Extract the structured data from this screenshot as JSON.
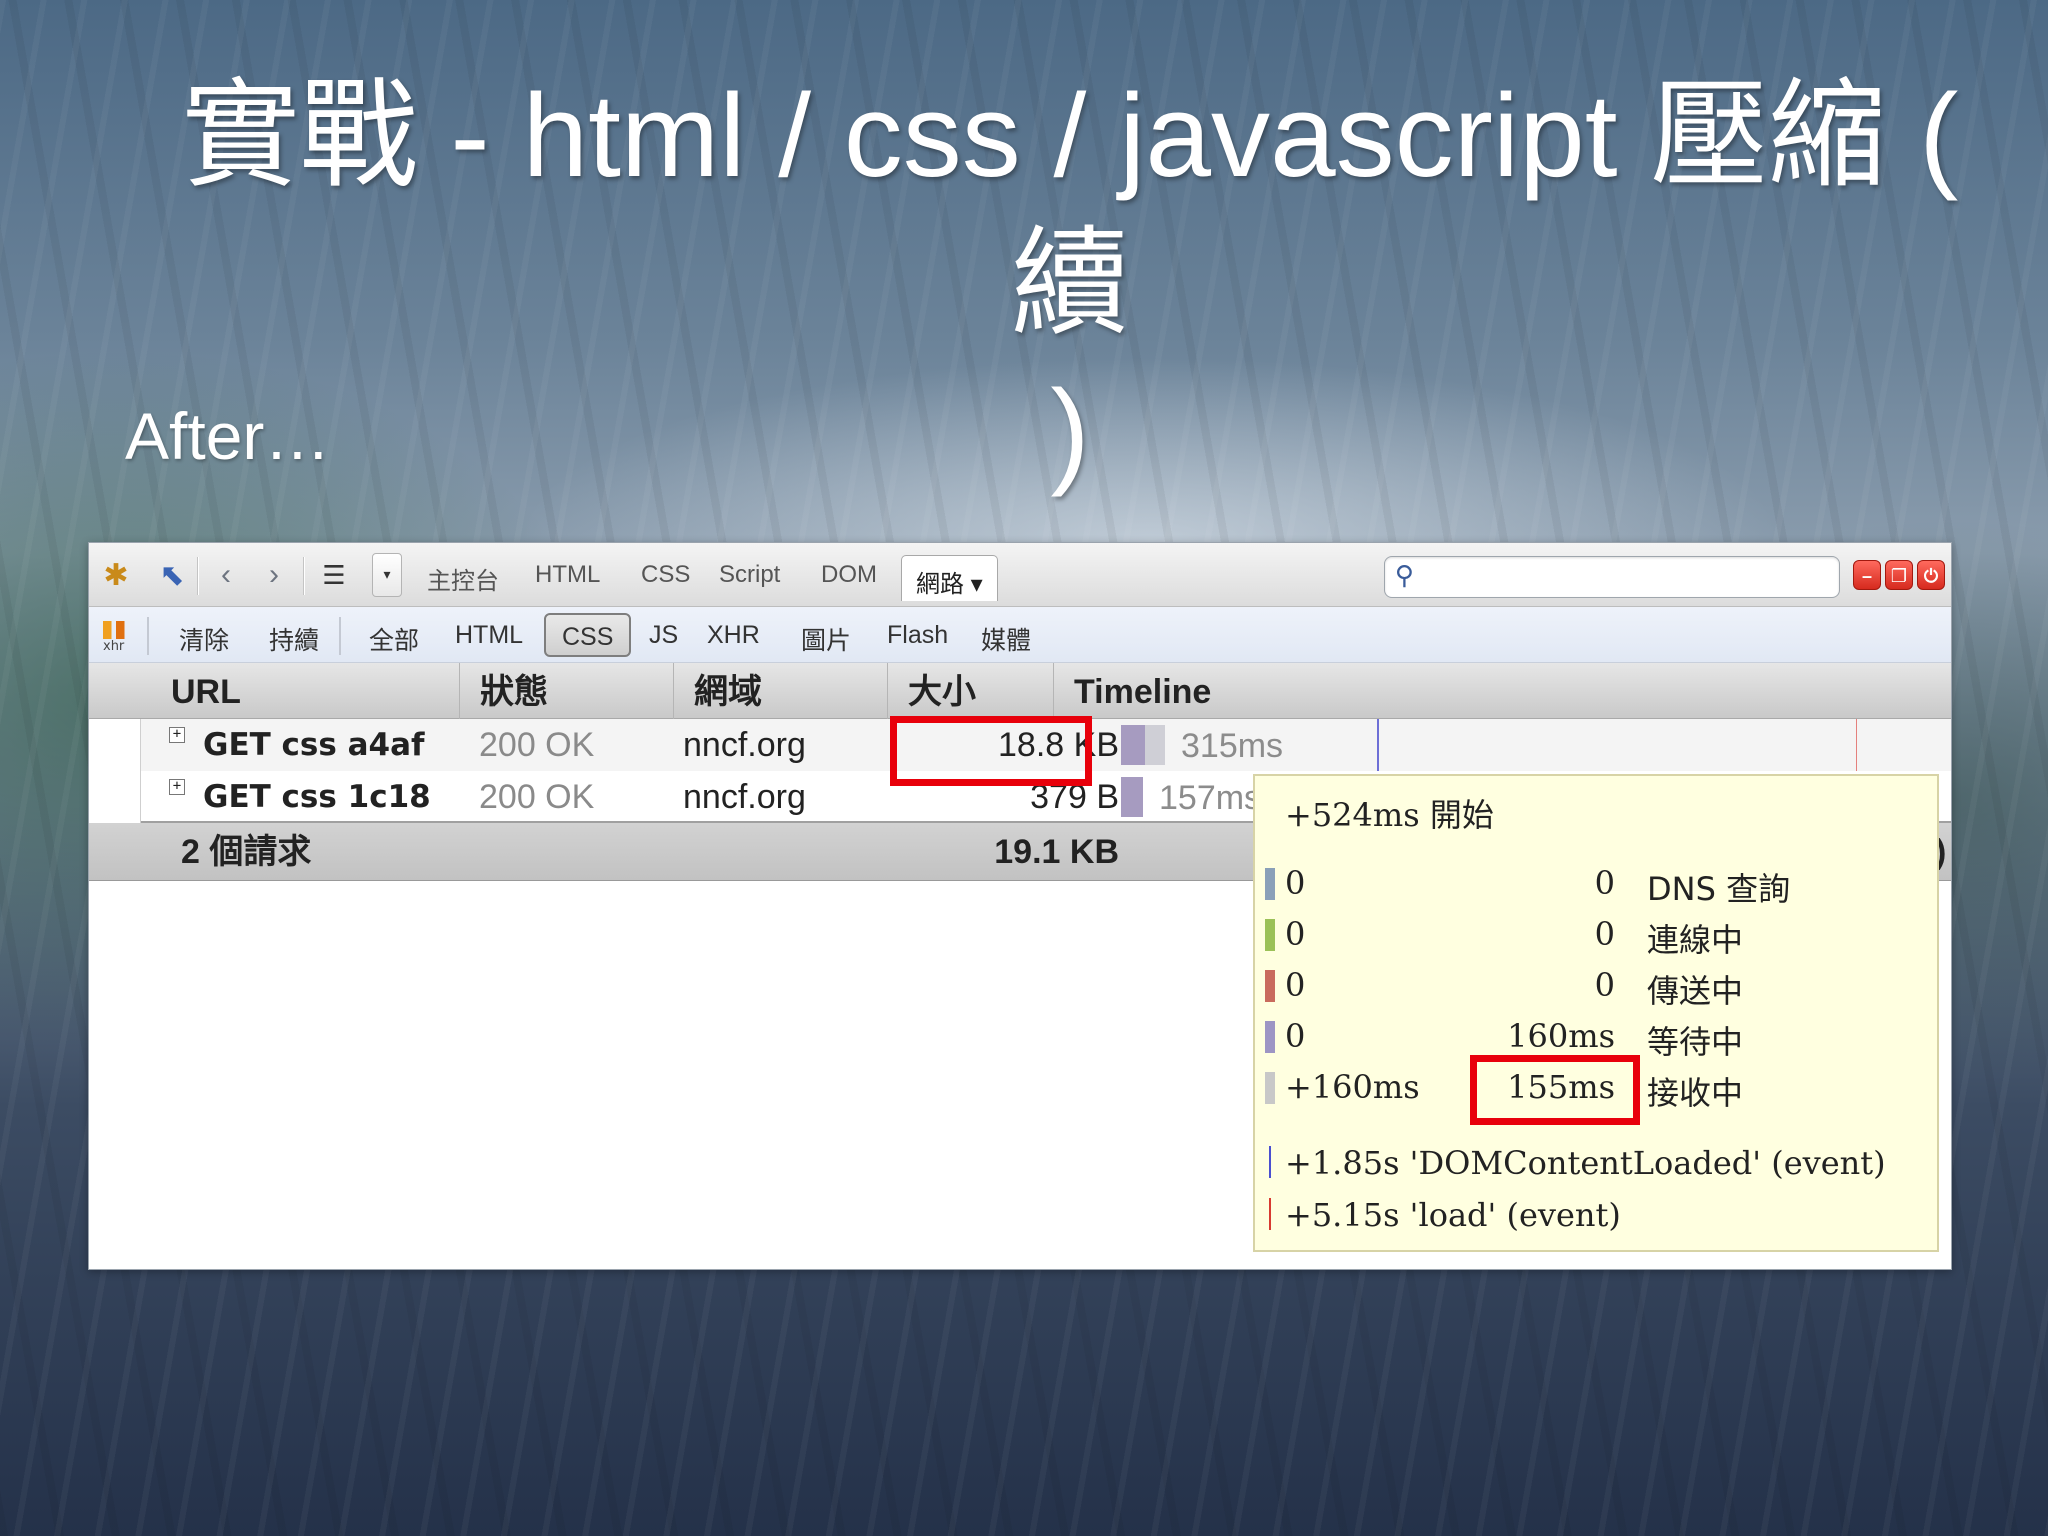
{
  "slide": {
    "title_line1": "實戰   - html / css / javascript  壓縮 ( 續",
    "title_line2": ")",
    "bullet": "After…"
  },
  "toolbar": {
    "tabs": [
      "主控台",
      "HTML",
      "CSS",
      "Script",
      "DOM"
    ],
    "active_tab": "網路 ▾",
    "search_placeholder": ""
  },
  "filterbar": {
    "xhr_icon_text": "xhr",
    "clear": "清除",
    "persist": "持續",
    "filters": [
      "全部",
      "HTML",
      "CSS",
      "JS",
      "XHR",
      "圖片",
      "Flash",
      "媒體"
    ],
    "active_filter": "CSS"
  },
  "columns": [
    "URL",
    "狀態",
    "網域",
    "大小",
    "Timeline"
  ],
  "requests": [
    {
      "expander": "+",
      "url": "GET css  a4af",
      "status": "200 OK",
      "domain": "nncf.org",
      "size": "18.8 KB",
      "timeline": "315ms"
    },
    {
      "expander": "+",
      "url": "GET css  1c18",
      "status": "200 OK",
      "domain": "nncf.org",
      "size": "379 B",
      "timeline": "157ms"
    }
  ],
  "summary": {
    "count": "2 個請求",
    "size": "19.1 KB",
    "edge": ")"
  },
  "tooltip": {
    "header": "+524ms  開始",
    "phases": [
      {
        "start": "0",
        "duration": "0",
        "label": "DNS 查詢",
        "color": "#8aa0b8"
      },
      {
        "start": "0",
        "duration": "0",
        "label": "連線中",
        "color": "#9bc157"
      },
      {
        "start": "0",
        "duration": "0",
        "label": "傳送中",
        "color": "#c96b5d"
      },
      {
        "start": "0",
        "duration": "160ms",
        "label": "等待中",
        "color": "#9d95c4"
      },
      {
        "start": "+160ms",
        "duration": "155ms",
        "label": "接收中",
        "color": "#c8c8c8"
      }
    ],
    "events": [
      {
        "text": "+1.85s  'DOMContentLoaded'  (event)",
        "color": "#4a4fd0"
      },
      {
        "text": "+5.15s  'load'  (event)",
        "color": "#d83a32"
      }
    ]
  },
  "highlight_color": "#e8000b"
}
